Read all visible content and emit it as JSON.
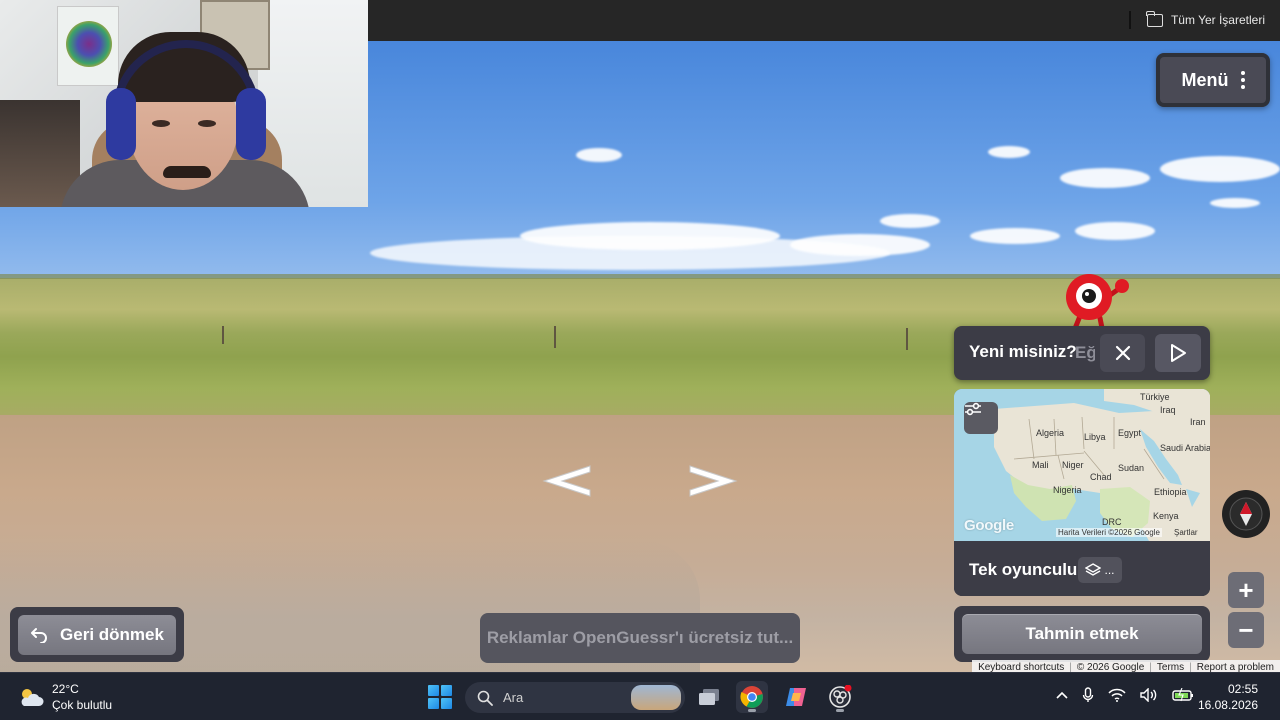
{
  "browser": {
    "bookmarks_label": "Tüm Yer İşaretleri"
  },
  "game": {
    "menu_label": "Menü",
    "welcome": {
      "text": "Yeni misiniz?",
      "overflow_text": "Eğ"
    },
    "map": {
      "labels": {
        "turkiye": "Türkiye",
        "iraq": "Iraq",
        "iran": "Iran",
        "algeria": "Algeria",
        "libya": "Libya",
        "egypt": "Egypt",
        "saudi_arabia": "Saudi Arabia",
        "mali": "Mali",
        "niger": "Niger",
        "sudan": "Sudan",
        "chad": "Chad",
        "nigeria": "Nigeria",
        "ethiopia": "Ethiopia",
        "kenya": "Kenya",
        "drc": "DRC"
      },
      "logo": "Google",
      "attribution": "Harita Verileri ©2026 Google",
      "terms": "Şartlar"
    },
    "mode_label": "Tek oyunculu",
    "layers_label": "...",
    "guess_label": "Tahmin etmek",
    "back_label": "Geri dönmek",
    "ad_text": "Reklamlar OpenGuessr'ı ücretsiz tut...",
    "zoom_in": "+",
    "zoom_out": "−",
    "footer": {
      "shortcuts": "Keyboard shortcuts",
      "copyright": "© 2026 Google",
      "terms": "Terms",
      "report": "Report a problem"
    }
  },
  "taskbar": {
    "weather_temp": "22°C",
    "weather_desc": "Çok bulutlu",
    "search_placeholder": "Ara",
    "time": "02:55",
    "date": "16.08.2026"
  },
  "colors": {
    "panel": "#3c3c46",
    "button": "#808089",
    "taskbar": "#1f2430",
    "mascot_red": "#e01b24"
  },
  "icons": [
    "folder-icon",
    "kebab-icon",
    "close-icon",
    "play-icon",
    "settings-sliders-icon",
    "layers-icon",
    "back-arrow-icon",
    "compass-icon",
    "search-icon",
    "windows-icon",
    "chrome-icon",
    "copilot-icon",
    "wifi-icon",
    "volume-icon",
    "battery-icon",
    "microphone-icon",
    "chevron-up-icon",
    "weather-cloud-icon"
  ]
}
